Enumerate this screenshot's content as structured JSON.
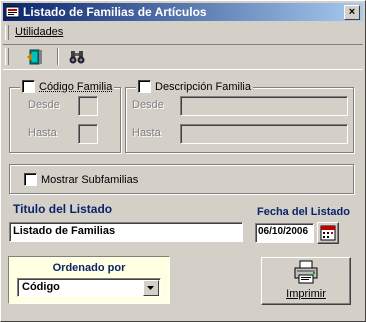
{
  "window": {
    "title": "Listado de Familias de Artículos",
    "close_glyph": "×"
  },
  "menu": {
    "utilidades": "Utilidades"
  },
  "toolbar": {
    "icons": [
      "exit-door-icon",
      "binoculars-search-icon"
    ]
  },
  "codigo_group": {
    "label": "Código Familia",
    "checked": false,
    "desde_label": "Desde",
    "hasta_label": "Hasta",
    "desde_value": "",
    "hasta_value": ""
  },
  "descripcion_group": {
    "label": "Descripción Familia",
    "checked": false,
    "desde_label": "Desde",
    "hasta_label": "Hasta",
    "desde_value": "",
    "hasta_value": ""
  },
  "subfamilias": {
    "label": "Mostrar Subfamilias",
    "checked": false
  },
  "titulo": {
    "label": "Titulo del Listado",
    "value": "Listado de Familias"
  },
  "fecha": {
    "label": "Fecha del Listado",
    "value": "06/10/2006",
    "calendar_icon": "calendar-icon"
  },
  "ordenado": {
    "label": "Ordenado por",
    "selected": "Código"
  },
  "imprimir": {
    "label": "Imprimir",
    "icon": "printer-icon"
  },
  "colors": {
    "title_gradient_start": "#0a246a",
    "title_gradient_end": "#a6caf0",
    "face": "#d4d0c8",
    "heading_text": "#0a246a",
    "tooltip_bg": "#ffffe1"
  }
}
